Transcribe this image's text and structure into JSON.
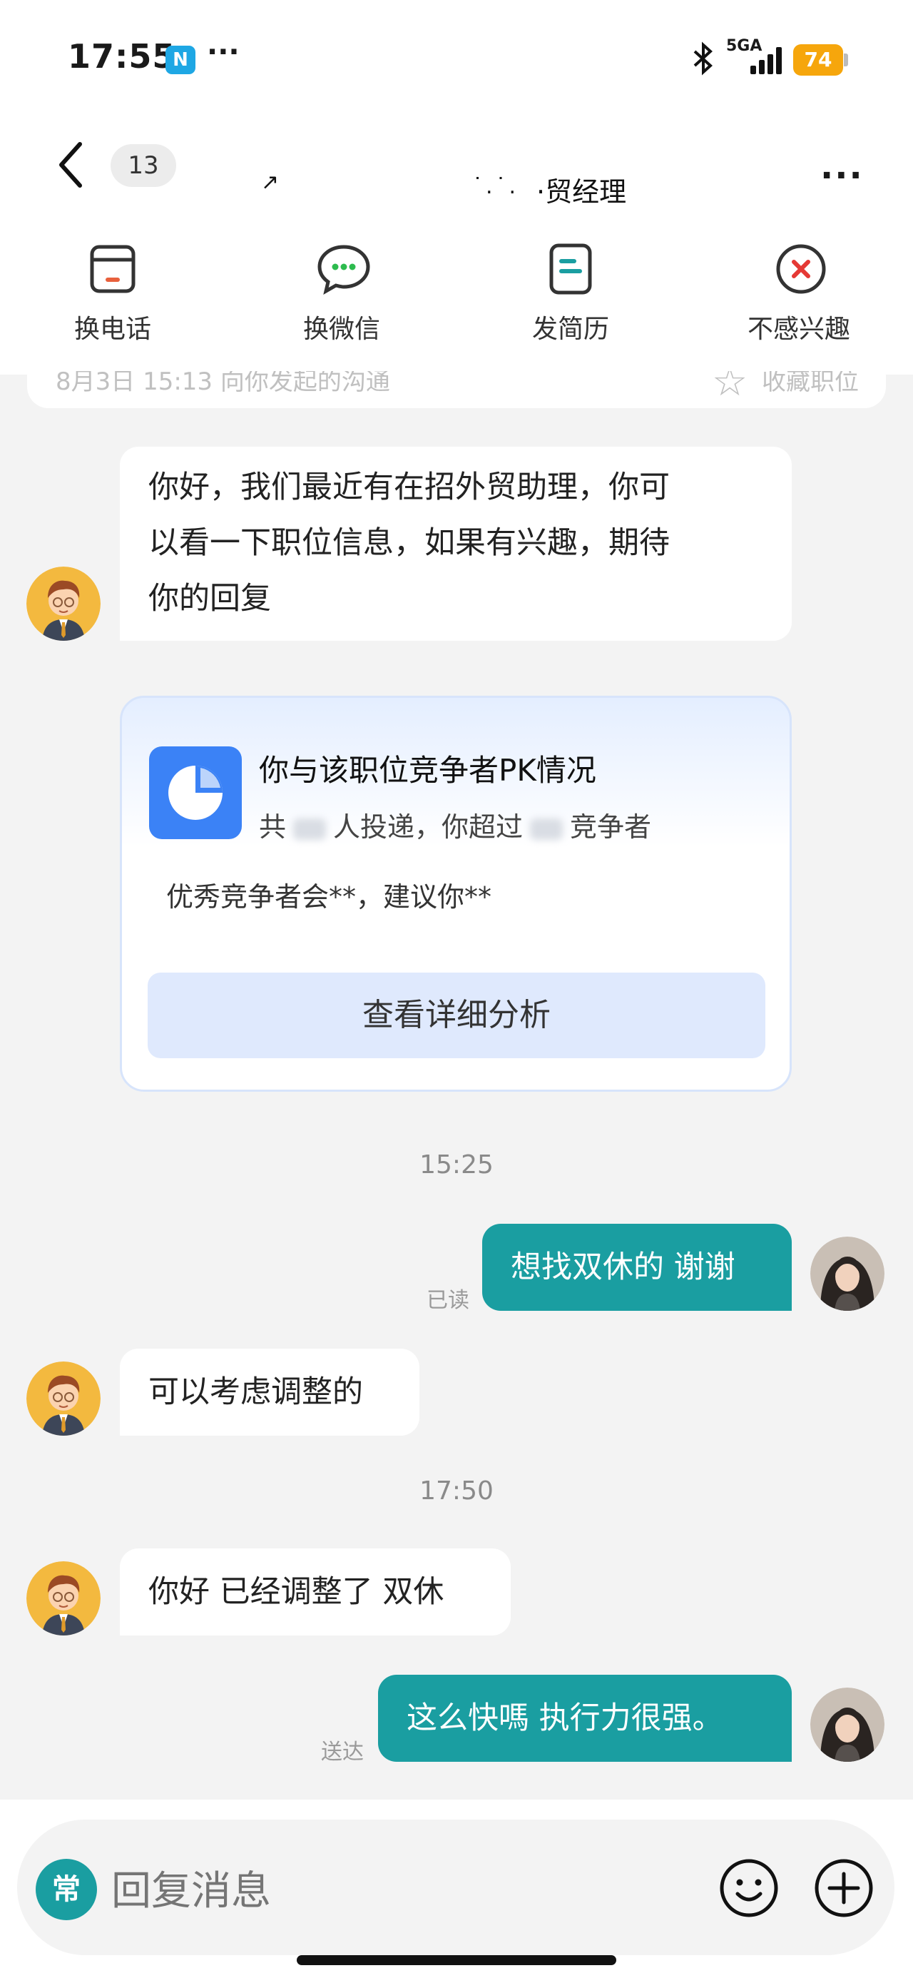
{
  "status_bar": {
    "time": "17:55",
    "nfc": "N",
    "more": "···",
    "network": "5GA",
    "battery": "74"
  },
  "header": {
    "unread_count": "13",
    "title_fragment_1": "↗",
    "title_fragment_2": "˙.˙.",
    "title": "·贸经理",
    "more": "···"
  },
  "actions": [
    {
      "label": "换电话",
      "icon": "phone-swap-icon"
    },
    {
      "label": "换微信",
      "icon": "wechat-icon"
    },
    {
      "label": "发简历",
      "icon": "resume-icon"
    },
    {
      "label": "不感兴趣",
      "icon": "not-interested-icon"
    }
  ],
  "strip": {
    "left_text": "8月3日 15:13 向你发起的沟通",
    "right_text": "收藏职位",
    "star": "☆"
  },
  "messages": {
    "m1_line1": "你好，我们最近有在招外贸助理，你可",
    "m1_line2": "以看一下职位信息，如果有兴趣，期待",
    "m1_line3": "你的回复",
    "ts1": "15:25",
    "m2": "想找双休的 谢谢",
    "m2_status": "已读",
    "m3": "可以考虑调整的",
    "ts2": "17:50",
    "m4": "你好 已经调整了 双休",
    "m5": "这么快嗎 执行力很强。",
    "m5_status": "送达"
  },
  "pk_card": {
    "title": "你与该职位竞争者PK情况",
    "sub_prefix": "共",
    "sub_mid": "人投递，你超过",
    "sub_suffix": "竞争者",
    "tip": "优秀竞争者会**，建议你**",
    "button": "查看详细分析"
  },
  "input": {
    "quick_reply": "常",
    "placeholder": "回复消息"
  },
  "colors": {
    "accent": "#1a9ea1",
    "card_icon": "#3b82f6",
    "battery": "#f6a60c"
  }
}
